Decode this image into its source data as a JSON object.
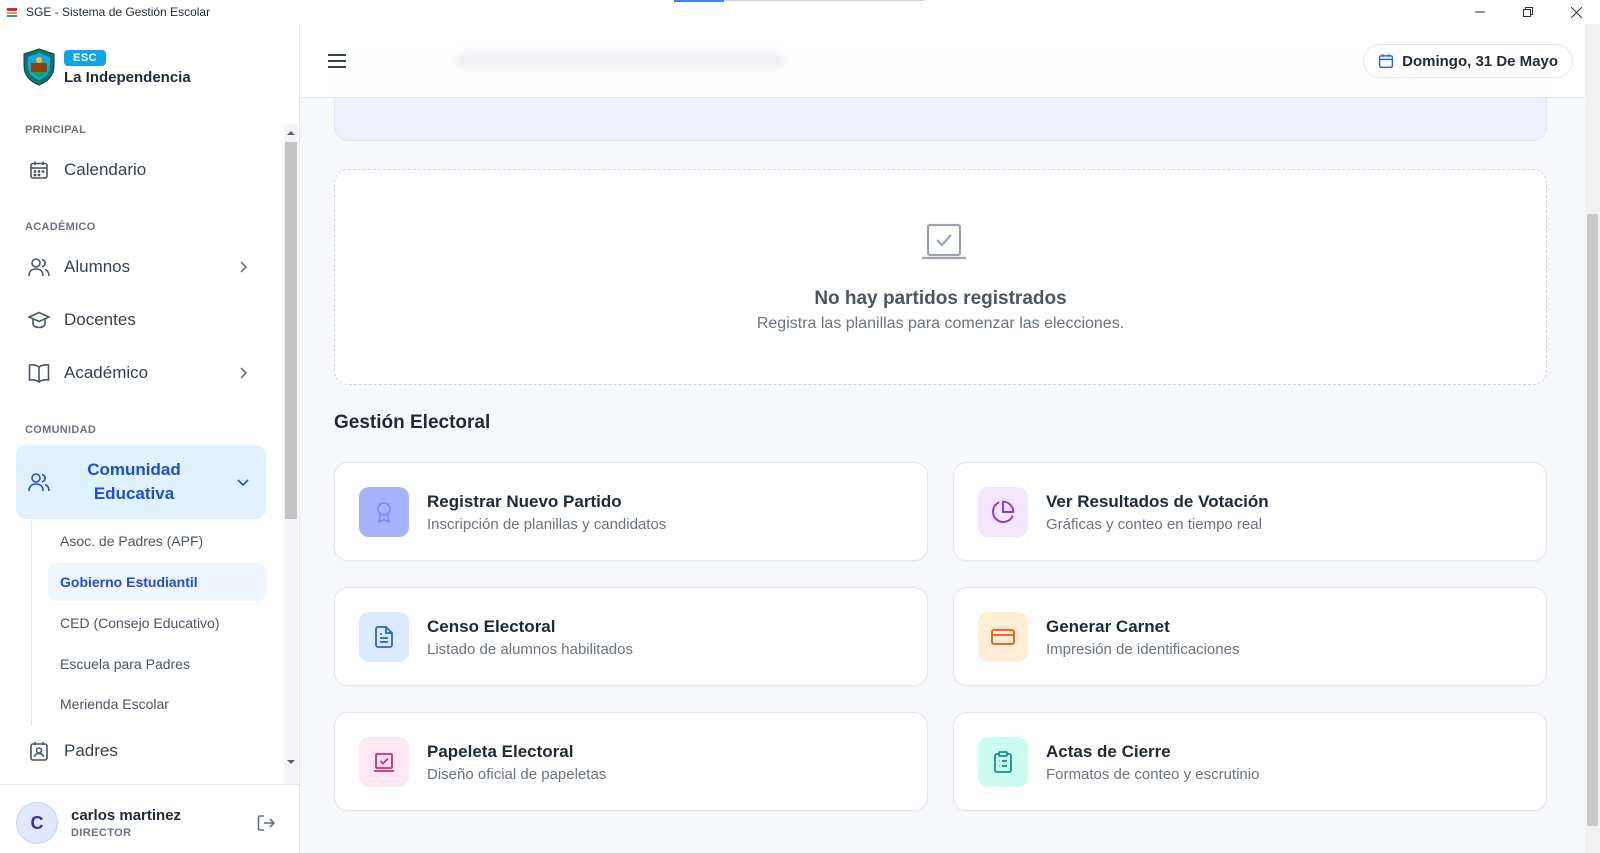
{
  "window": {
    "title": "SGE - Sistema de Gestión Escolar"
  },
  "brand": {
    "badge": "ESC",
    "school_name": "La Independencia"
  },
  "sidebar": {
    "sections": {
      "principal": "PRINCIPAL",
      "academico": "ACADÉMICO",
      "comunidad": "COMUNIDAD"
    },
    "items": {
      "calendario": "Calendario",
      "alumnos": "Alumnos",
      "docentes": "Docentes",
      "academico": "Académico",
      "comunidad_line1": "Comunidad",
      "comunidad_line2": "Educativa",
      "padres": "Padres"
    },
    "subitems": [
      {
        "label": "Asoc. de Padres (APF)",
        "active": false
      },
      {
        "label": "Gobierno Estudiantil",
        "active": true
      },
      {
        "label": "CED (Consejo Educativo)",
        "active": false
      },
      {
        "label": "Escuela para Padres",
        "active": false
      },
      {
        "label": "Merienda Escolar",
        "active": false
      }
    ]
  },
  "user": {
    "initial": "C",
    "name": "carlos martinez",
    "role": "DIRECTOR"
  },
  "header": {
    "date": "Domingo, 31 De Mayo"
  },
  "empty_state": {
    "title": "No hay partidos registrados",
    "subtitle": "Registra las planillas para comenzar las elecciones."
  },
  "electoral": {
    "section_title": "Gestión Electoral",
    "cards": [
      {
        "title": "Registrar Nuevo Partido",
        "subtitle": "Inscripción de planillas y candidatos",
        "icon": "award-icon",
        "color": "#6366f1"
      },
      {
        "title": "Ver Resultados de Votación",
        "subtitle": "Gráficas y conteo en tiempo real",
        "icon": "pie-chart-icon",
        "color": "#9333ea"
      },
      {
        "title": "Censo Electoral",
        "subtitle": "Listado de alumnos habilitados",
        "icon": "document-icon",
        "color": "#2563eb"
      },
      {
        "title": "Generar Carnet",
        "subtitle": "Impresión de identificaciones",
        "icon": "id-card-icon",
        "color": "#ea580c"
      },
      {
        "title": "Papeleta Electoral",
        "subtitle": "Diseño oficial de papeletas",
        "icon": "ballot-icon",
        "color": "#db2777"
      },
      {
        "title": "Actas de Cierre",
        "subtitle": "Formatos de conteo y escrutinio",
        "icon": "clipboard-icon",
        "color": "#0d9488"
      }
    ]
  }
}
